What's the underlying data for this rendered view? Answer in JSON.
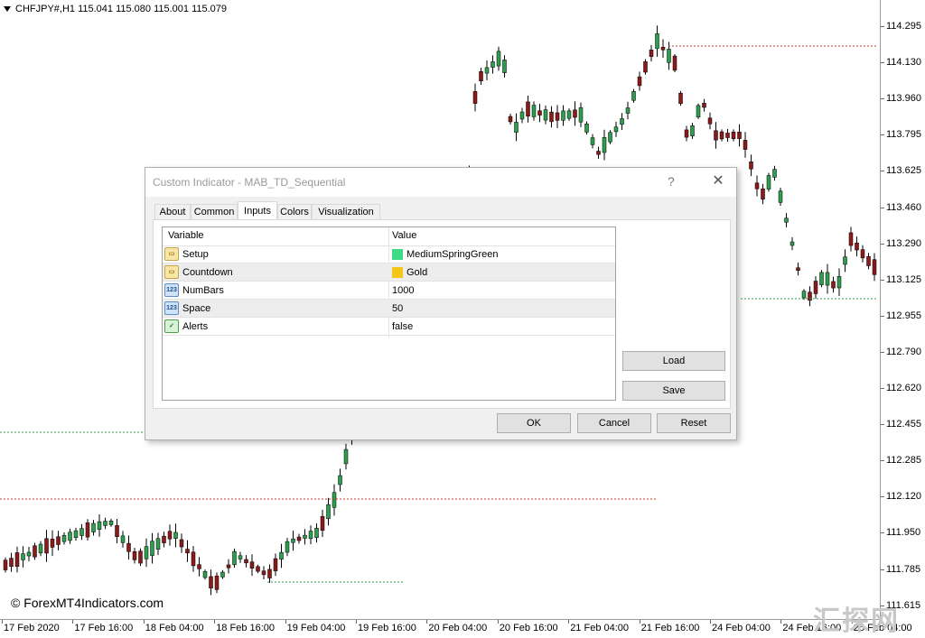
{
  "chart": {
    "header": "CHFJPY#,H1  115.041 115.080 115.001 115.079",
    "price_labels": [
      "114.295",
      "114.130",
      "113.960",
      "113.795",
      "113.625",
      "113.460",
      "113.290",
      "113.125",
      "112.955",
      "112.790",
      "112.620",
      "112.455",
      "112.285",
      "112.120",
      "111.950",
      "111.785",
      "111.615"
    ],
    "time_labels": [
      "17 Feb 2020",
      "17 Feb 16:00",
      "18 Feb 04:00",
      "18 Feb 16:00",
      "19 Feb 04:00",
      "19 Feb 16:00",
      "20 Feb 04:00",
      "20 Feb 16:00",
      "21 Feb 04:00",
      "21 Feb 16:00",
      "24 Feb 04:00",
      "24 Feb 16:00",
      "25 Feb 04:00"
    ],
    "watermark": "© ForexMT4Indicators.com",
    "corner_mark": "汇探网",
    "colors": {
      "bull": "#2e9e4e",
      "bear": "#8b1a1a",
      "support": "#2e9e4e",
      "resistance": "#c0392b"
    }
  },
  "dialog": {
    "title": "Custom Indicator - MAB_TD_Sequential",
    "help_label": "?",
    "close_label": "✕",
    "tabs": [
      {
        "label": "About"
      },
      {
        "label": "Common"
      },
      {
        "label": "Inputs"
      },
      {
        "label": "Colors"
      },
      {
        "label": "Visualization"
      }
    ],
    "active_tab": "Inputs",
    "grid": {
      "col_variable": "Variable",
      "col_value": "Value",
      "rows": [
        {
          "name": "Setup",
          "value": "MediumSpringGreen",
          "icon": "color-param-icon",
          "swatch": "#3ddc84"
        },
        {
          "name": "Countdown",
          "value": "Gold",
          "icon": "color-param-icon",
          "swatch": "#f5c518"
        },
        {
          "name": "NumBars",
          "value": "1000",
          "icon": "integer-param-icon",
          "icon_text": "123"
        },
        {
          "name": "Space",
          "value": "50",
          "icon": "integer-param-icon",
          "icon_text": "123"
        },
        {
          "name": "Alerts",
          "value": "false",
          "icon": "bool-param-icon"
        }
      ]
    },
    "buttons": {
      "load": "Load",
      "save": "Save",
      "ok": "OK",
      "cancel": "Cancel",
      "reset": "Reset"
    }
  }
}
